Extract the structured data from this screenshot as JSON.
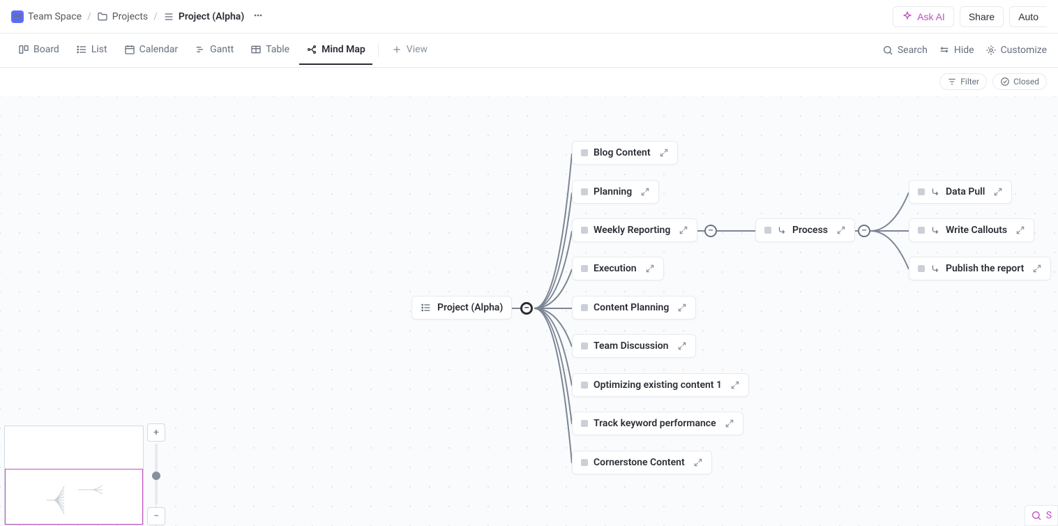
{
  "breadcrumb": {
    "space": "Team Space",
    "folder": "Projects",
    "current": "Project (Alpha)"
  },
  "topbar": {
    "ask_ai": "Ask AI",
    "share": "Share",
    "automations": "Auto"
  },
  "views": {
    "board": "Board",
    "list": "List",
    "calendar": "Calendar",
    "gantt": "Gantt",
    "table": "Table",
    "mindmap": "Mind Map",
    "add_view": "View"
  },
  "view_actions": {
    "search": "Search",
    "hide": "Hide",
    "customize": "Customize"
  },
  "filters": {
    "filter": "Filter",
    "closed": "Closed"
  },
  "mindmap": {
    "root": "Project (Alpha)",
    "level1": [
      "Blog Content",
      "Planning",
      "Weekly Reporting",
      "Execution",
      "Content Planning",
      "Team Discussion",
      "Optimizing existing content 1",
      "Track keyword performance",
      "Cornerstone Content"
    ],
    "process_node": "Process",
    "level3": [
      "Data Pull",
      "Write Callouts",
      "Publish the report"
    ]
  },
  "bottom_right": "S"
}
